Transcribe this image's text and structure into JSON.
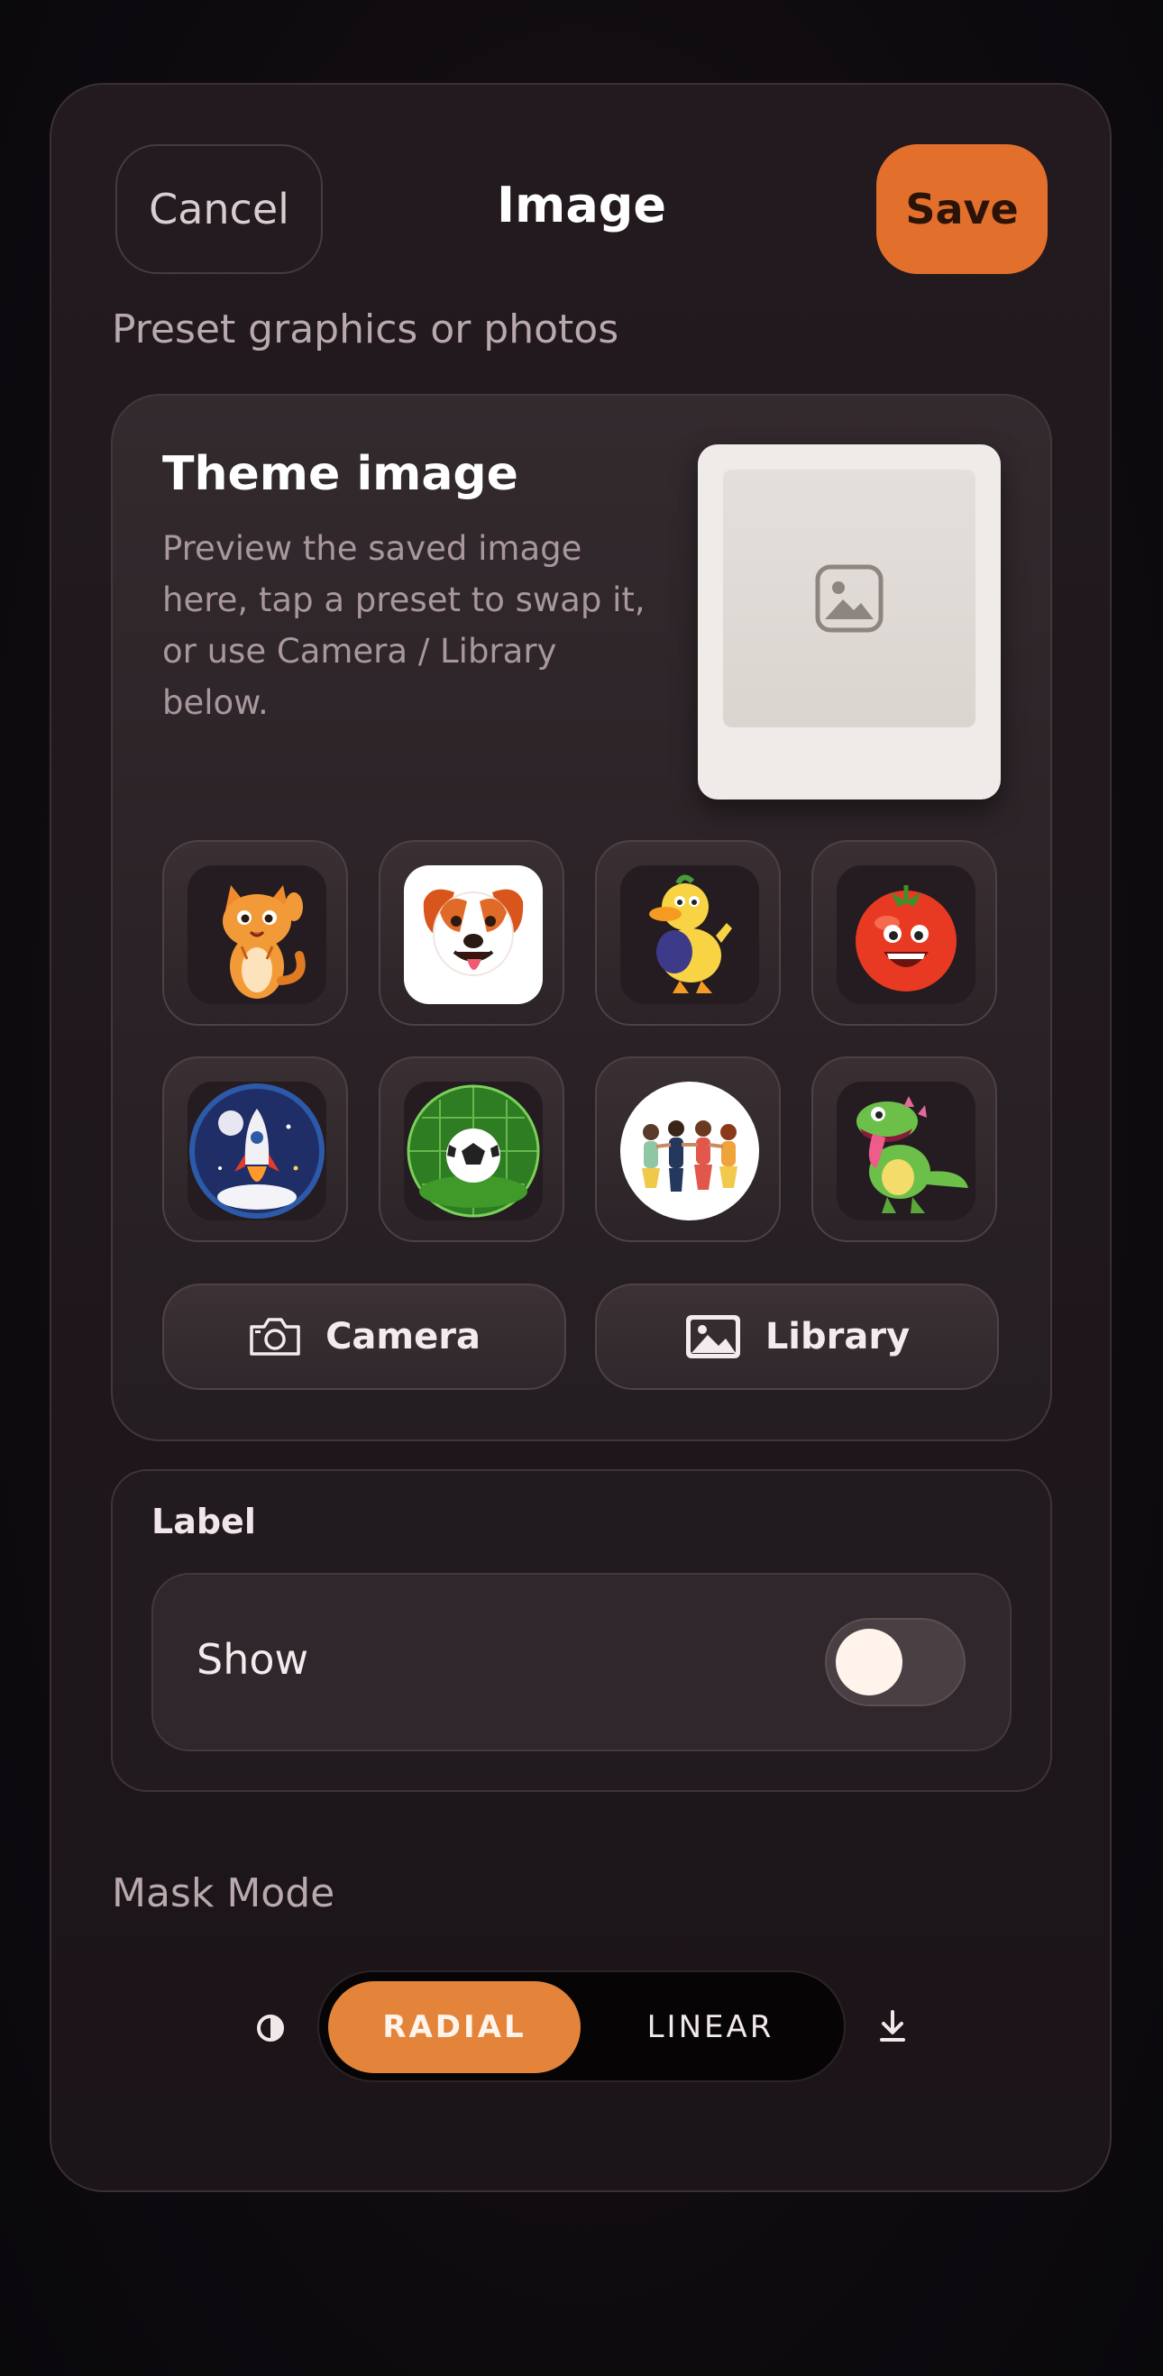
{
  "header": {
    "cancel_label": "Cancel",
    "title": "Image",
    "save_label": "Save"
  },
  "preset_caption": "Preset graphics or photos",
  "theme_card": {
    "title": "Theme image",
    "description": "Preview the saved image here, tap a preset to swap it, or use Camera / Library below.",
    "preview_icon": "image-placeholder-icon",
    "presets": [
      {
        "name": "cat",
        "icon": "cat-waving-icon"
      },
      {
        "name": "dog",
        "icon": "dog-face-icon"
      },
      {
        "name": "duck",
        "icon": "duck-thumbs-up-icon"
      },
      {
        "name": "tomato",
        "icon": "tomato-face-icon"
      },
      {
        "name": "rocket",
        "icon": "rocket-icon"
      },
      {
        "name": "soccer",
        "icon": "soccer-ball-icon"
      },
      {
        "name": "friends",
        "icon": "friends-group-icon"
      },
      {
        "name": "dinosaur",
        "icon": "dinosaur-icon"
      }
    ],
    "camera_label": "Camera",
    "library_label": "Library"
  },
  "label_section": {
    "title": "Label",
    "show_label": "Show",
    "show_enabled": false
  },
  "mask": {
    "caption": "Mask Mode",
    "options": [
      "RADIAL",
      "LINEAR"
    ],
    "selected": "RADIAL"
  },
  "colors": {
    "accent": "#e36f2c",
    "segment_active": "#e3843a",
    "background": "#0e0b0f",
    "card": "#2a2226"
  }
}
